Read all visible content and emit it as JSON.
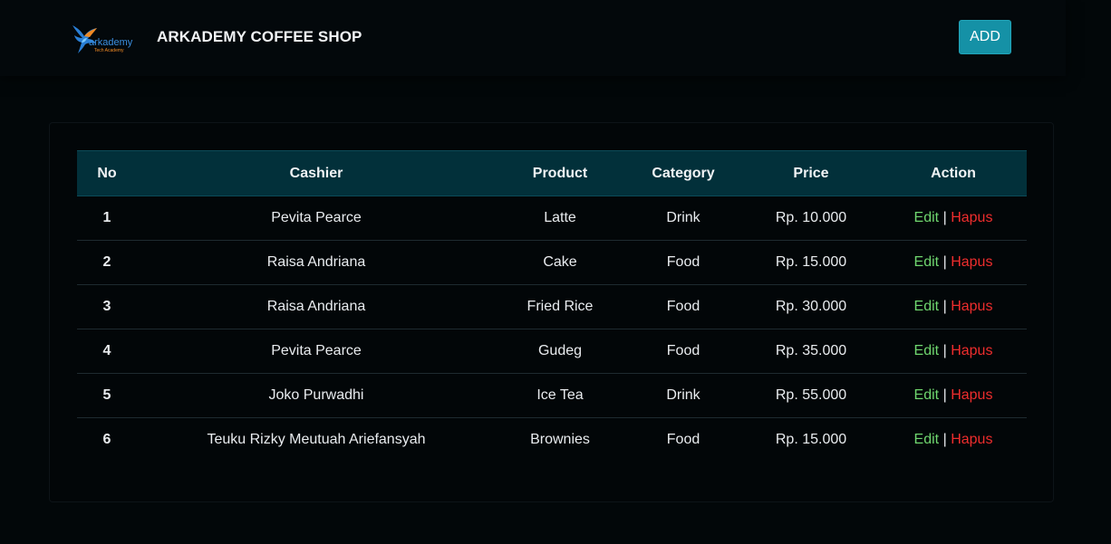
{
  "header": {
    "brand_title": "ARKADEMY COFFEE SHOP",
    "logo": {
      "text": "arkademy",
      "subtext": "Tech Academy",
      "icon": "hummingbird-logo-icon"
    },
    "add_label": "ADD"
  },
  "table": {
    "columns": [
      "No",
      "Cashier",
      "Product",
      "Category",
      "Price",
      "Action"
    ],
    "rows": [
      {
        "no": "1",
        "cashier": "Pevita Pearce",
        "product": "Latte",
        "category": "Drink",
        "price": "Rp. 10.000"
      },
      {
        "no": "2",
        "cashier": "Raisa Andriana",
        "product": "Cake",
        "category": "Food",
        "price": "Rp. 15.000"
      },
      {
        "no": "3",
        "cashier": "Raisa Andriana",
        "product": "Fried Rice",
        "category": "Food",
        "price": "Rp. 30.000"
      },
      {
        "no": "4",
        "cashier": "Pevita Pearce",
        "product": "Gudeg",
        "category": "Food",
        "price": "Rp. 35.000"
      },
      {
        "no": "5",
        "cashier": "Joko Purwadhi",
        "product": "Ice Tea",
        "category": "Drink",
        "price": "Rp. 55.000"
      },
      {
        "no": "6",
        "cashier": "Teuku Rizky Meutuah Ariefansyah",
        "product": "Brownies",
        "category": "Food",
        "price": "Rp. 15.000"
      }
    ],
    "actions": {
      "edit_label": "Edit",
      "separator": "|",
      "delete_label": "Hapus"
    }
  },
  "colors": {
    "background": "#020709",
    "accent_button": "#1591a6",
    "table_header": "#02303a",
    "edit": "#6fd66f",
    "delete": "#ef2d2d"
  }
}
